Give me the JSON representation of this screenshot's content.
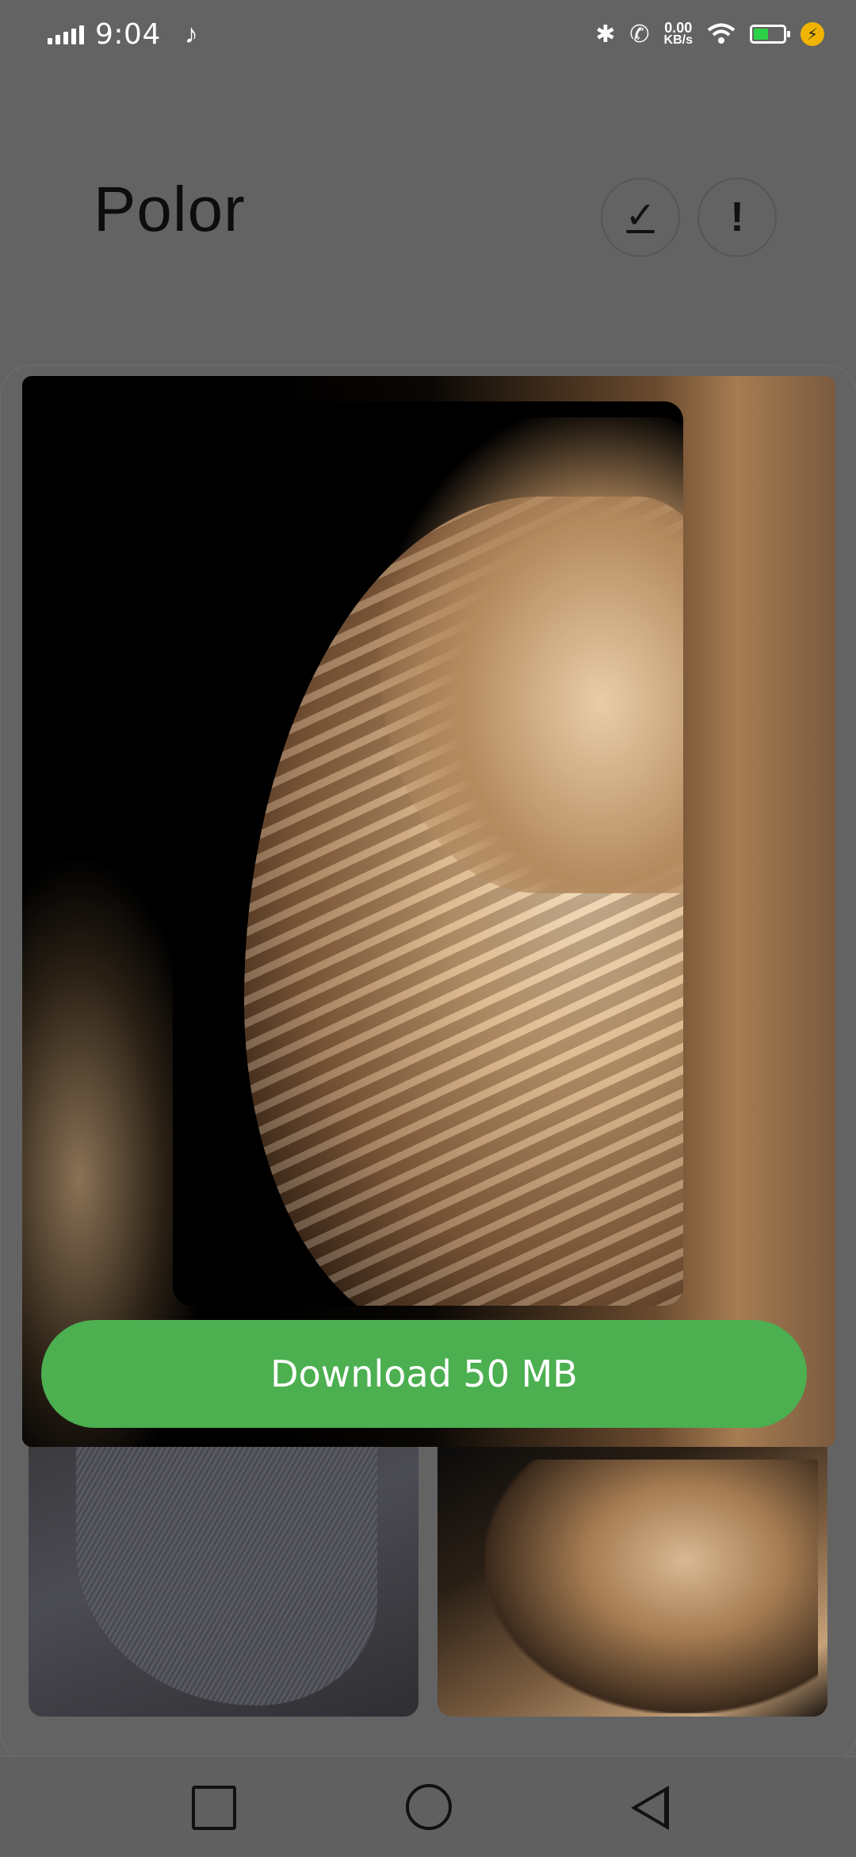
{
  "status_bar": {
    "time": "9:04",
    "note_icon": "music-note-icon",
    "speed_value": "0.00",
    "speed_unit": "KB/s",
    "icons": [
      "bluetooth-icon",
      "vibrate-icon",
      "wifi-calling-icon",
      "wifi-icon",
      "battery-icon",
      "charging-icon"
    ]
  },
  "header": {
    "title": "Polor",
    "check_icon": "download-done-icon",
    "info_icon": "exclamation-icon"
  },
  "preview": {
    "download_label": "Download 50 MB"
  },
  "nav": {
    "recent_icon": "square-icon",
    "home_icon": "circle-icon",
    "back_icon": "triangle-back-icon"
  },
  "colors": {
    "accent": "#4caf50",
    "scrim": "#636363"
  }
}
